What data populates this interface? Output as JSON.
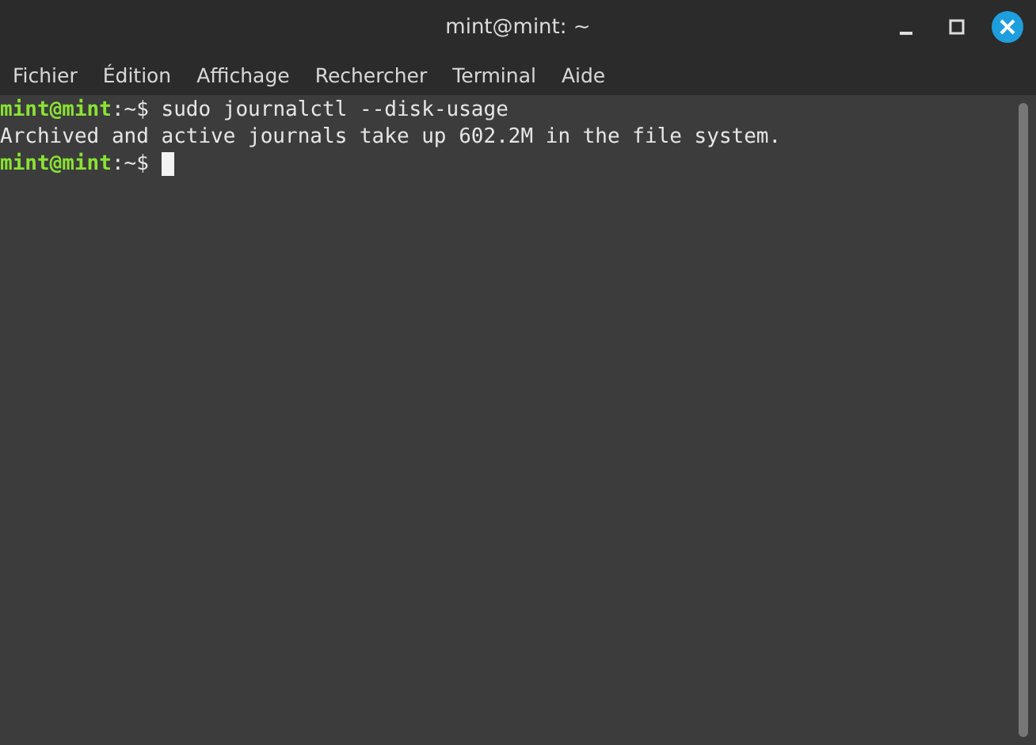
{
  "window": {
    "title": "mint@mint: ~"
  },
  "menu": [
    "Fichier",
    "Édition",
    "Affichage",
    "Rechercher",
    "Terminal",
    "Aide"
  ],
  "terminal": {
    "lines": [
      {
        "kind": "prompt",
        "user": "mint@mint",
        "path": ":~$",
        "command": "sudo journalctl --disk-usage",
        "cursor": false
      },
      {
        "kind": "output",
        "text": "Archived and active journals take up 602.2M in the file system."
      },
      {
        "kind": "prompt",
        "user": "mint@mint",
        "path": ":~$",
        "cursor": true
      }
    ]
  }
}
